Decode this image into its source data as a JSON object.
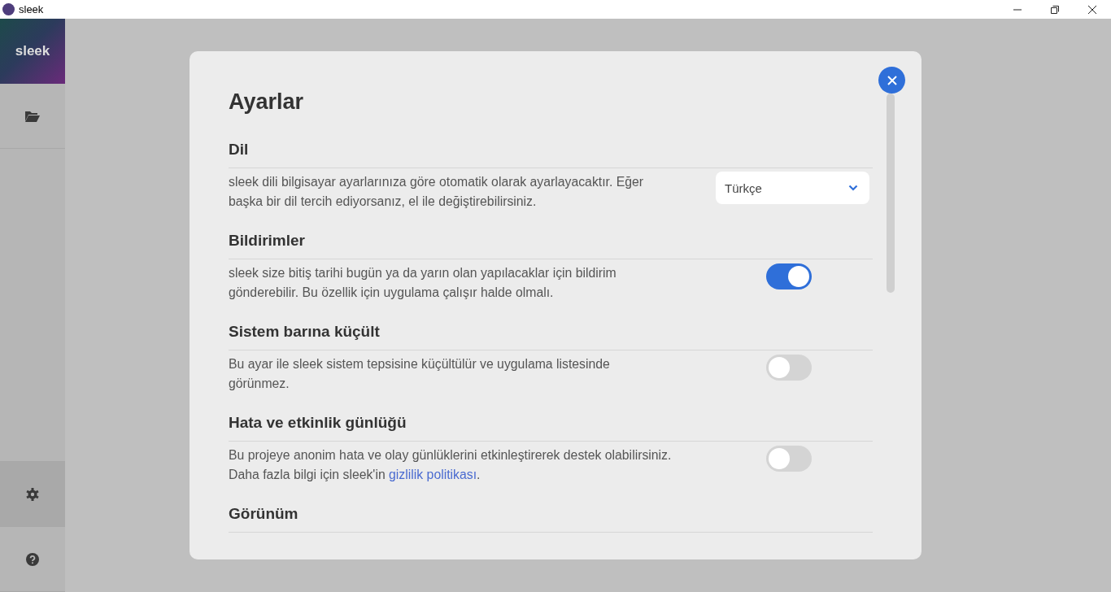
{
  "window": {
    "title": "sleek"
  },
  "sidebar": {
    "logo": "sleek",
    "items": [
      {
        "kind": "folder",
        "selected": false
      },
      {
        "kind": "settings",
        "selected": true
      },
      {
        "kind": "help",
        "selected": false
      }
    ]
  },
  "settings": {
    "title": "Ayarlar",
    "sections": [
      {
        "kind": "select",
        "title": "Dil",
        "description": "sleek dili bilgisayar ayarlarınıza göre otomatik olarak ayarlayacaktır. Eğer başka bir dil tercih ediyorsanız, el ile değiştirebilirsiniz.",
        "value": "Türkçe"
      },
      {
        "kind": "toggle",
        "title": "Bildirimler",
        "description": "sleek size bitiş tarihi bugün ya da yarın olan yapılacaklar için bildirim gönderebilir. Bu özellik için uygulama çalışır halde olmalı.",
        "on": true
      },
      {
        "kind": "toggle",
        "title": "Sistem barına küçült",
        "description": "Bu ayar ile sleek sistem tepsisine küçültülür ve uygulama listesinde görünmez.",
        "on": false
      },
      {
        "kind": "toggle",
        "title": "Hata ve etkinlik günlüğü",
        "description": "Bu projeye anonim hata ve olay günlüklerini etkinleştirerek destek olabilirsiniz. Daha fazla bilgi için sleek'in ",
        "link": "gizlilik politikası",
        "description_end": ".",
        "on": false
      },
      {
        "kind": "heading",
        "title": "Görünüm"
      }
    ]
  }
}
